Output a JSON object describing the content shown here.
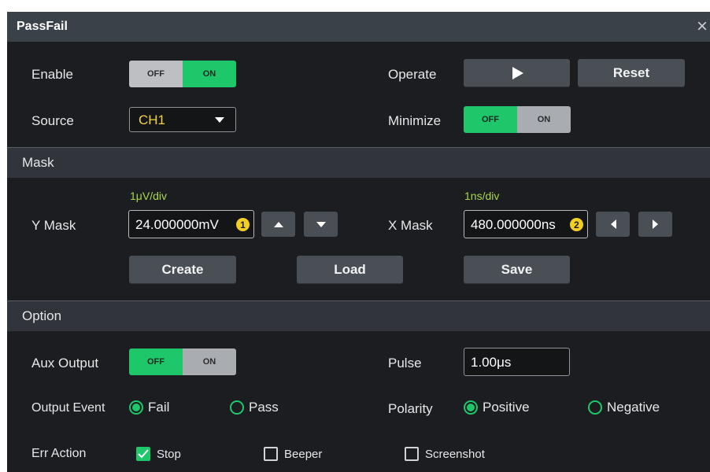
{
  "dialog": {
    "title": "PassFail",
    "close_glyph": "×"
  },
  "top": {
    "enable_label": "Enable",
    "enable_toggle": {
      "off": "OFF",
      "on": "ON",
      "state": "on"
    },
    "operate_label": "Operate",
    "operate_icon": "play-icon",
    "reset_label": "Reset",
    "source_label": "Source",
    "source_value": "CH1",
    "minimize_label": "Minimize",
    "minimize_toggle": {
      "off": "OFF",
      "on": "ON",
      "state": "off"
    }
  },
  "mask": {
    "section_label": "Mask",
    "y_scale": "1μV/div",
    "y_label": "Y Mask",
    "y_value": "24.000000mV",
    "y_badge": "1",
    "x_scale": "1ns/div",
    "x_label": "X Mask",
    "x_value": "480.000000ns",
    "x_badge": "2",
    "create_label": "Create",
    "load_label": "Load",
    "save_label": "Save"
  },
  "option": {
    "section_label": "Option",
    "aux_label": "Aux Output",
    "aux_toggle": {
      "off": "OFF",
      "on": "ON",
      "state": "off"
    },
    "pulse_label": "Pulse",
    "pulse_value": "1.00μs",
    "event_label": "Output Event",
    "event_fail": "Fail",
    "event_pass": "Pass",
    "event_selected": "Fail",
    "polarity_label": "Polarity",
    "polarity_positive": "Positive",
    "polarity_negative": "Negative",
    "polarity_selected": "Positive",
    "err_label": "Err Action",
    "err_stop": "Stop",
    "err_beeper": "Beeper",
    "err_screenshot": "Screenshot",
    "err_checked": [
      "Stop"
    ]
  },
  "colors": {
    "accent_green": "#1ec76a",
    "scale_green": "#a8d84a",
    "badge_yellow": "#f2cf22",
    "panel_bg": "#1c1d20"
  }
}
